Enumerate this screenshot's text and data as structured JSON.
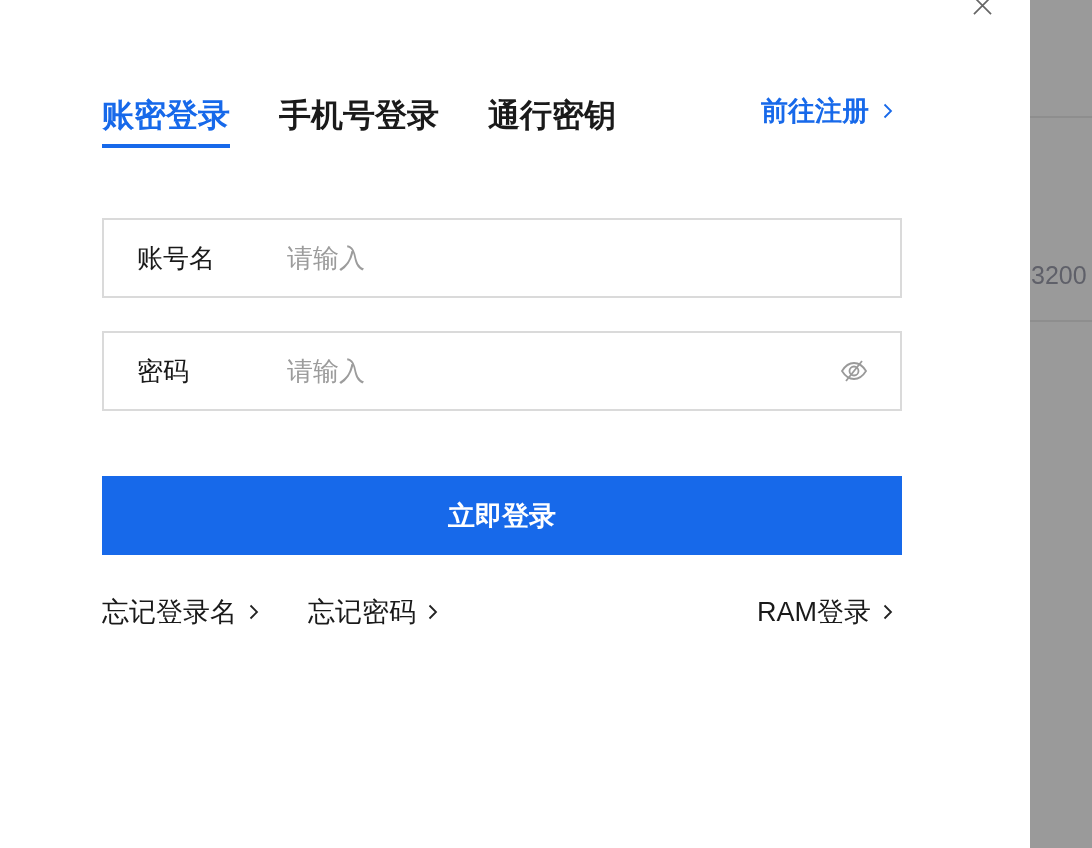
{
  "tabs": [
    {
      "label": "账密登录",
      "selected": true
    },
    {
      "label": "手机号登录",
      "selected": false
    },
    {
      "label": "通行密钥",
      "selected": false
    }
  ],
  "register_link": {
    "label": "前往注册"
  },
  "fields": [
    {
      "kind": "text",
      "label": "账号名",
      "placeholder": "请输入"
    },
    {
      "kind": "password",
      "label": "密码",
      "placeholder": "请输入"
    }
  ],
  "submit_button": {
    "label": "立即登录"
  },
  "footer_links": [
    {
      "label": "忘记登录名"
    },
    {
      "label": "忘记密码"
    }
  ],
  "ram_link": {
    "label": "RAM登录"
  },
  "background_page": {
    "text": "3200"
  }
}
